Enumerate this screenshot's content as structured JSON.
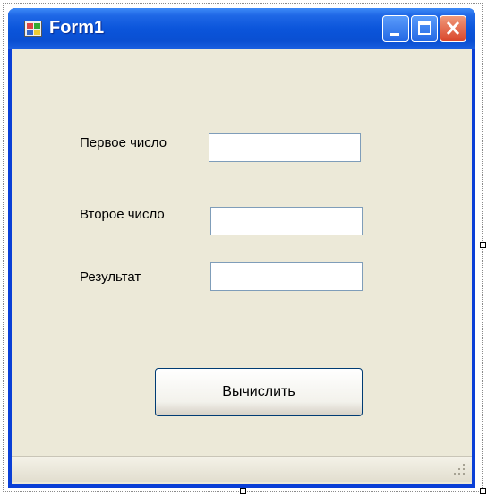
{
  "window": {
    "title": "Form1",
    "controls": {
      "minimize": "minimize-icon",
      "maximize": "maximize-icon",
      "close": "close-icon"
    }
  },
  "form": {
    "first_label": "Первое число",
    "first_value": "",
    "second_label": "Второе число",
    "second_value": "",
    "result_label": "Результат",
    "result_value": "",
    "calculate_button": "Вычислить"
  },
  "colors": {
    "titlebar": "#0a4fd2",
    "client_background": "#ece9d8",
    "close_button": "#d9452b",
    "textbox_border": "#7f9db9"
  }
}
